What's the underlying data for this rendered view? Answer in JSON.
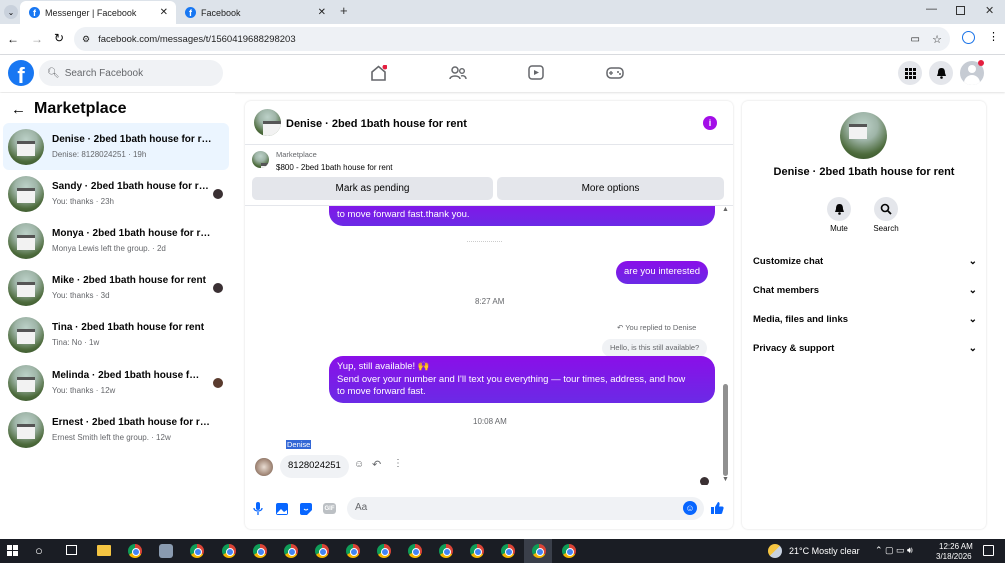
{
  "browser": {
    "tabs": [
      {
        "label": "Messenger | Facebook"
      },
      {
        "label": "Facebook"
      }
    ],
    "url": "facebook.com/messages/t/1560419688298203"
  },
  "fb": {
    "logo": "f",
    "search_placeholder": "Search Facebook"
  },
  "left": {
    "title": "Marketplace",
    "conversations": [
      {
        "name": "Denise · 2bed 1bath house for rent",
        "preview": "Denise: 8128024251 · 19h"
      },
      {
        "name": "Sandy · 2bed 1bath house for rent",
        "preview": "You: thanks · 23h"
      },
      {
        "name": "Monya · 2bed 1bath house for rent",
        "preview": "Monya Lewis left the group. · 2d"
      },
      {
        "name": "Mike · 2bed 1bath house for rent",
        "preview": "You: thanks · 3d"
      },
      {
        "name": "Tina · 2bed 1bath house for rent",
        "preview": "Tina: No · 1w"
      },
      {
        "name": "Melinda · 2bed 1bath house for ...",
        "preview": "You: thanks · 12w"
      },
      {
        "name": "Ernest · 2bed 1bath house for rent",
        "preview": "Ernest Smith left the group. · 12w"
      }
    ]
  },
  "chat": {
    "title": "Denise · 2bed 1bath house for rent",
    "listing_label": "Marketplace",
    "listing_detail": "$800 - 2bed 1bath house for rent",
    "pending_button": "Mark as pending",
    "more_button": "More options",
    "msg_cut": "to move forward fast.thank you.",
    "msg_interested": "are you interested",
    "time1": "8:27 AM",
    "replied_label": "You replied to Denise",
    "quoted": "Hello, is this still available?",
    "reply_line1": "Yup, still available! 🙌",
    "reply_line2": "Send over your number and I'll text you everything — tour times, address, and how",
    "reply_line3": "to move forward fast.",
    "time2": "10:08 AM",
    "sender_name": "Denise",
    "incoming": "8128024251",
    "input_placeholder": "Aa"
  },
  "right": {
    "title": "Denise · 2bed 1bath house for rent",
    "mute_label": "Mute",
    "search_label": "Search",
    "sections": [
      "Customize chat",
      "Chat members",
      "Media, files and links",
      "Privacy & support"
    ]
  },
  "taskbar": {
    "weather": "21°C  Mostly clear",
    "time": "12:26 AM",
    "date": "3/18/2026"
  },
  "colors": {
    "brand": "#1877f2",
    "outgoing": "#7a0ee8",
    "info": "#a30ee8"
  }
}
